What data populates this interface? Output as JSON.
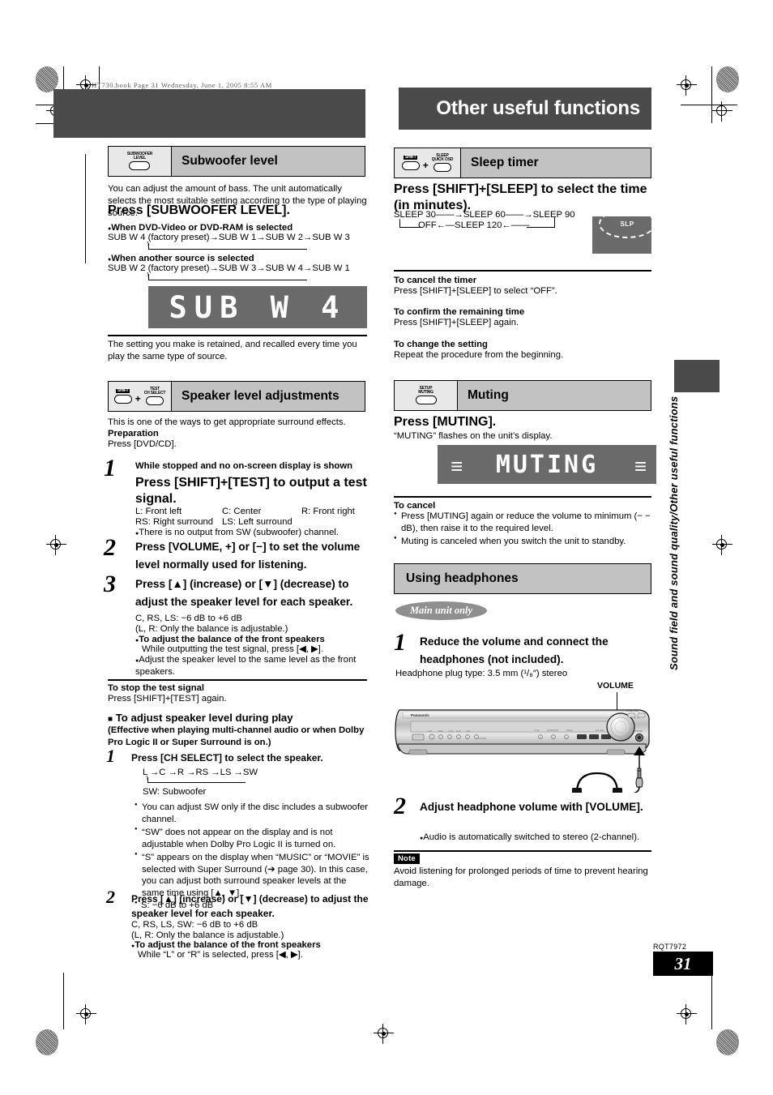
{
  "file_header": "HT730.book  Page 31  Wednesday,  June 1,  2005  8:55 AM",
  "page_title": "Other useful functions",
  "side_tab": "Sound field and sound quality/Other useful functions",
  "footer": {
    "code": "RQT7972",
    "page": "31"
  },
  "subwoofer": {
    "key_label_line1": "SUBWOOFER",
    "key_label_line2": "LEVEL",
    "heading": "Subwoofer level",
    "intro": "You can adjust the amount of bass. The unit automatically selects the most suitable setting according to the type of playing source.",
    "press": "Press [SUBWOOFER LEVEL].",
    "bullet1_title": "When DVD-Video or DVD-RAM is selected",
    "bullet1_chain": "SUB W 4 (factory preset)→SUB W 1→SUB W 2→SUB W 3",
    "bullet2_title": "When another source is selected",
    "bullet2_chain": "SUB W 2 (factory preset)→SUB W 3→SUB W 4→SUB W 1",
    "display_text": "SUB W 4",
    "footnote": "The setting you make is retained, and recalled every time you play the same type of source."
  },
  "speaker_level": {
    "key1_label": "SHIFT",
    "key2_label_line1": "TEST",
    "key2_label_line2": "CH SELECT",
    "plus": "+",
    "heading": "Speaker level adjustments",
    "intro": "This is one of the ways to get appropriate surround effects.",
    "prep_title": "Preparation",
    "prep_text": "Press [DVD/CD].",
    "step1_num": "1",
    "step1_cond": "While stopped and no on-screen display is shown",
    "step1_title": "Press [SHIFT]+[TEST] to output a test signal.",
    "step1_l": "L:  Front left",
    "step1_c": "C:  Center",
    "step1_r": "R:  Front right",
    "step1_rs": "RS:  Right surround",
    "step1_ls": "LS:  Left surround",
    "step1_note": "There is no output from SW (subwoofer) channel.",
    "step2_num": "2",
    "step2_title": "Press [VOLUME, +] or [−] to set the volume level normally used for listening.",
    "step3_num": "3",
    "step3_title": "Press [▲] (increase) or [▼] (decrease) to adjust the speaker level for each speaker.",
    "step3_range": "C, RS, LS: −6 dB to +6 dB",
    "step3_paren": "(L, R: Only the balance is adjustable.)",
    "step3_b1_title": "To adjust the balance of the front speakers",
    "step3_b1_text": "While outputting the test signal, press [◀, ▶].",
    "step3_b2_text": "Adjust the speaker level to the same level as the front speakers.",
    "stop_title": "To stop the test signal",
    "stop_text": "Press [SHIFT]+[TEST] again.",
    "during_play_title": "To adjust speaker level during play",
    "during_play_sub": "(Effective when playing multi-channel audio or when Dolby Pro Logic II or Super Surround is on.)",
    "dp_step1_num": "1",
    "dp_step1_title": "Press [CH SELECT] to select the speaker.",
    "dp_chain": "L →C →R →RS →LS →SW",
    "dp_sw": "SW: Subwoofer",
    "dp_b1": "You can adjust SW only if the disc includes a subwoofer channel.",
    "dp_b2": "“SW” does not appear on the display and is not adjustable when Dolby Pro Logic II is turned on.",
    "dp_b3": "“S” appears on the display when “MUSIC” or “MOVIE” is selected with Super Surround (➔ page 30). In this case, you can adjust both surround speaker levels at the same time using [▲, ▼].",
    "dp_b3_range": "S: −6 dB to +6 dB",
    "dp_step2_num": "2",
    "dp_step2_title": "Press [▲] (increase) or [▼] (decrease) to adjust the speaker level for each speaker.",
    "dp_step2_range": "C, RS, LS, SW: −6 dB to +6 dB",
    "dp_step2_paren": "(L, R: Only the balance is adjustable.)",
    "dp_step2_b1_title": "To adjust the balance of the front speakers",
    "dp_step2_b1_text": "While “L” or “R” is selected, press [◀, ▶]."
  },
  "sleep": {
    "key1_label": "SHIFT",
    "key2_label_line1": "SLEEP",
    "key2_label_line2": "QUICK OSD",
    "plus": "+",
    "heading": "Sleep timer",
    "press": "Press [SHIFT]+[SLEEP] to select the time (in minutes).",
    "chain_top": "SLEEP 30——→SLEEP 60——→SLEEP 90",
    "chain_bottom": "OFF←—SLEEP 120←——",
    "display_text": "SLP",
    "cancel_title": "To cancel the timer",
    "cancel_text": "Press [SHIFT]+[SLEEP] to select “OFF”.",
    "confirm_title": "To confirm the remaining time",
    "confirm_text": "Press [SHIFT]+[SLEEP] again.",
    "change_title": "To change the setting",
    "change_text": "Repeat the procedure from the beginning."
  },
  "muting": {
    "key_label_line1": "SETUP",
    "key_label_line2": "MUTING",
    "heading": "Muting",
    "press": "Press [MUTING].",
    "sub": "“MUTING” flashes on the unit’s display.",
    "display_text": "MUTING",
    "cancel_title": "To cancel",
    "cancel_b1": "Press [MUTING] again or reduce the volume to minimum (− − dB), then raise it to the required level.",
    "cancel_b2": "Muting is canceled when you switch the unit to standby."
  },
  "headphones": {
    "heading": "Using headphones",
    "badge": "Main unit only",
    "step1_num": "1",
    "step1_title": "Reduce the volume and connect the headphones (not included).",
    "step1_sub": "Headphone plug type:  3.5 mm (¹/₈″) stereo",
    "volume_label": "VOLUME",
    "brand": "Panasonic",
    "step2_num": "2",
    "step2_title": "Adjust headphone volume with [VOLUME].",
    "step2_b1": "Audio is automatically switched to stereo (2-channel).",
    "note_label": "Note",
    "note_text": "Avoid listening for prolonged periods of time to prevent hearing damage."
  }
}
